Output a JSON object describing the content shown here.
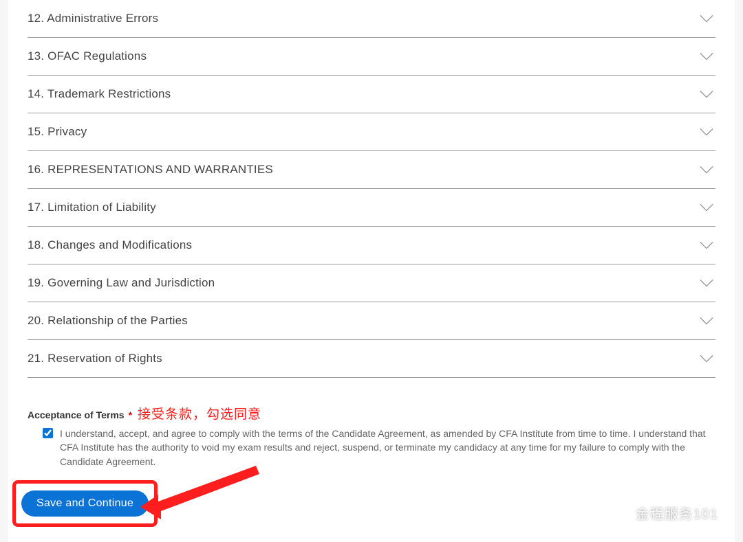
{
  "accordion": {
    "items": [
      {
        "label": "12. Administrative Errors"
      },
      {
        "label": "13. OFAC Regulations"
      },
      {
        "label": "14. Trademark Restrictions"
      },
      {
        "label": "15. Privacy"
      },
      {
        "label": "16. REPRESENTATIONS AND WARRANTIES"
      },
      {
        "label": "17. Limitation of Liability"
      },
      {
        "label": "18. Changes and Modifications"
      },
      {
        "label": "19. Governing Law and Jurisdiction"
      },
      {
        "label": "20. Relationship of the Parties"
      },
      {
        "label": "21. Reservation of Rights"
      }
    ]
  },
  "acceptance": {
    "title": "Acceptance of Terms",
    "required_mark": "*",
    "annotation": "接受条款，勾选同意",
    "checkbox_checked": true,
    "checkbox_text": "I understand, accept, and agree to comply with the terms of the Candidate Agreement, as amended by CFA Institute from time to time. I understand that CFA Institute has the authority to void my exam results and reject, suspend, or terminate my candidacy at any time for my failure to comply with the Candidate Agreement."
  },
  "actions": {
    "save_label": "Save and Continue"
  },
  "watermark": {
    "text": "金程服务101"
  }
}
